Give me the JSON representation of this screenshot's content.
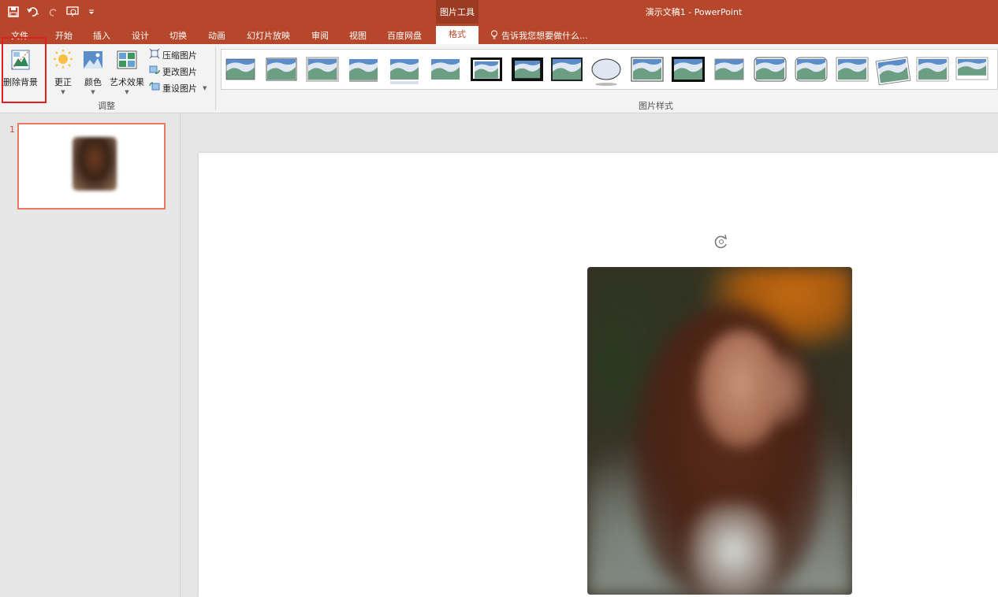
{
  "titlebar": {
    "context_label": "图片工具",
    "document_title": "演示文稿1 - PowerPoint",
    "qat": [
      "save-icon",
      "undo-icon",
      "redo-icon",
      "start-from-beginning-icon",
      "customize-qat-icon"
    ]
  },
  "tabs": [
    {
      "label": "文件"
    },
    {
      "label": "开始"
    },
    {
      "label": "插入"
    },
    {
      "label": "设计"
    },
    {
      "label": "切换"
    },
    {
      "label": "动画"
    },
    {
      "label": "幻灯片放映"
    },
    {
      "label": "审阅"
    },
    {
      "label": "视图"
    },
    {
      "label": "百度网盘"
    },
    {
      "label": "格式",
      "active": true
    }
  ],
  "tellme": {
    "text": "告诉我您想要做什么..."
  },
  "ribbon": {
    "adjust": {
      "remove_background": "删除背景",
      "corrections": "更正",
      "color": "颜色",
      "artistic_effects": "艺术效果",
      "compress": "压缩图片",
      "change": "更改图片",
      "reset": "重设图片",
      "group_label": "调整"
    },
    "styles": {
      "group_label": "图片样式",
      "count": 19
    }
  },
  "slides": {
    "thumbnails": [
      {
        "number": "1"
      }
    ]
  },
  "colors": {
    "accent": "#b7472a",
    "highlight_box": "#e31e1e",
    "thumb_outline": "#e8795a"
  }
}
